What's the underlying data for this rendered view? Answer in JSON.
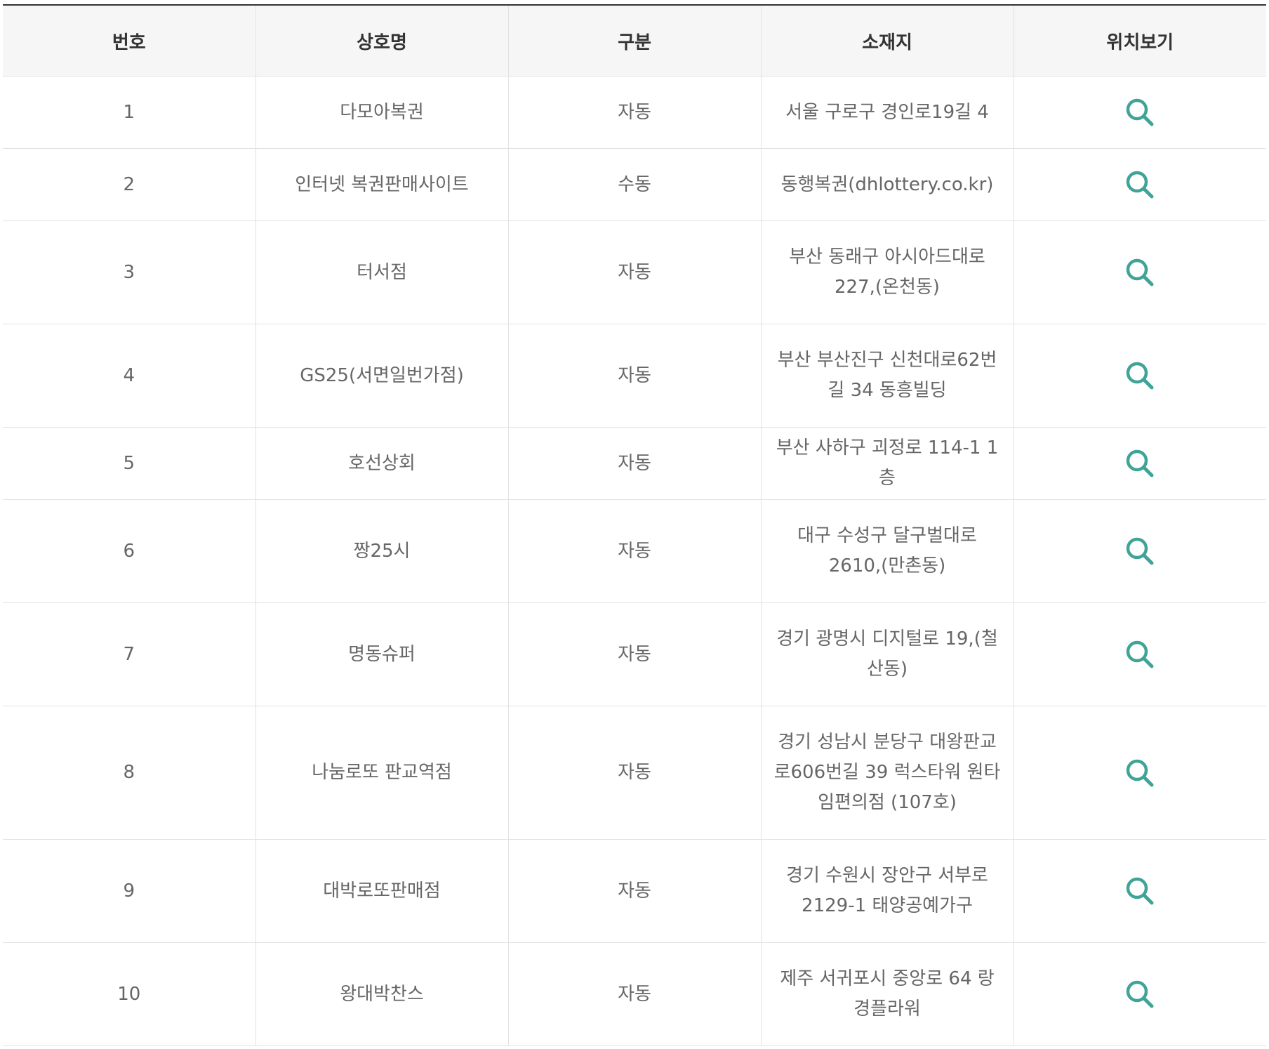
{
  "table": {
    "headers": [
      "번호",
      "상호명",
      "구분",
      "소재지",
      "위치보기"
    ],
    "rows": [
      {
        "no": "1",
        "name": "다모아복권",
        "type": "자동",
        "address": "서울 구로구 경인로19길 4"
      },
      {
        "no": "2",
        "name": "인터넷 복권판매사이트",
        "type": "수동",
        "address": "동행복권(dhlottery.co.kr)"
      },
      {
        "no": "3",
        "name": "터서점",
        "type": "자동",
        "address": "부산 동래구 아시아드대로 227,(온천동)"
      },
      {
        "no": "4",
        "name": "GS25(서면일번가점)",
        "type": "자동",
        "address": "부산 부산진구 신천대로62번길 34 동흥빌딩"
      },
      {
        "no": "5",
        "name": "호선상회",
        "type": "자동",
        "address": "부산 사하구 괴정로 114-1 1층"
      },
      {
        "no": "6",
        "name": "짱25시",
        "type": "자동",
        "address": "대구 수성구 달구벌대로 2610,(만촌동)"
      },
      {
        "no": "7",
        "name": "명동슈퍼",
        "type": "자동",
        "address": "경기 광명시 디지털로 19,(철산동)"
      },
      {
        "no": "8",
        "name": "나눔로또 판교역점",
        "type": "자동",
        "address": "경기 성남시 분당구 대왕판교로606번길 39 럭스타워 원타임편의점 (107호)"
      },
      {
        "no": "9",
        "name": "대박로또판매점",
        "type": "자동",
        "address": "경기 수원시 장안구 서부로 2129-1 태양공예가구"
      },
      {
        "no": "10",
        "name": "왕대박찬스",
        "type": "자동",
        "address": "제주 서귀포시 중앙로 64 랑경플라워"
      }
    ],
    "location_icon": "search-icon",
    "icon_color": "#3fa397"
  }
}
